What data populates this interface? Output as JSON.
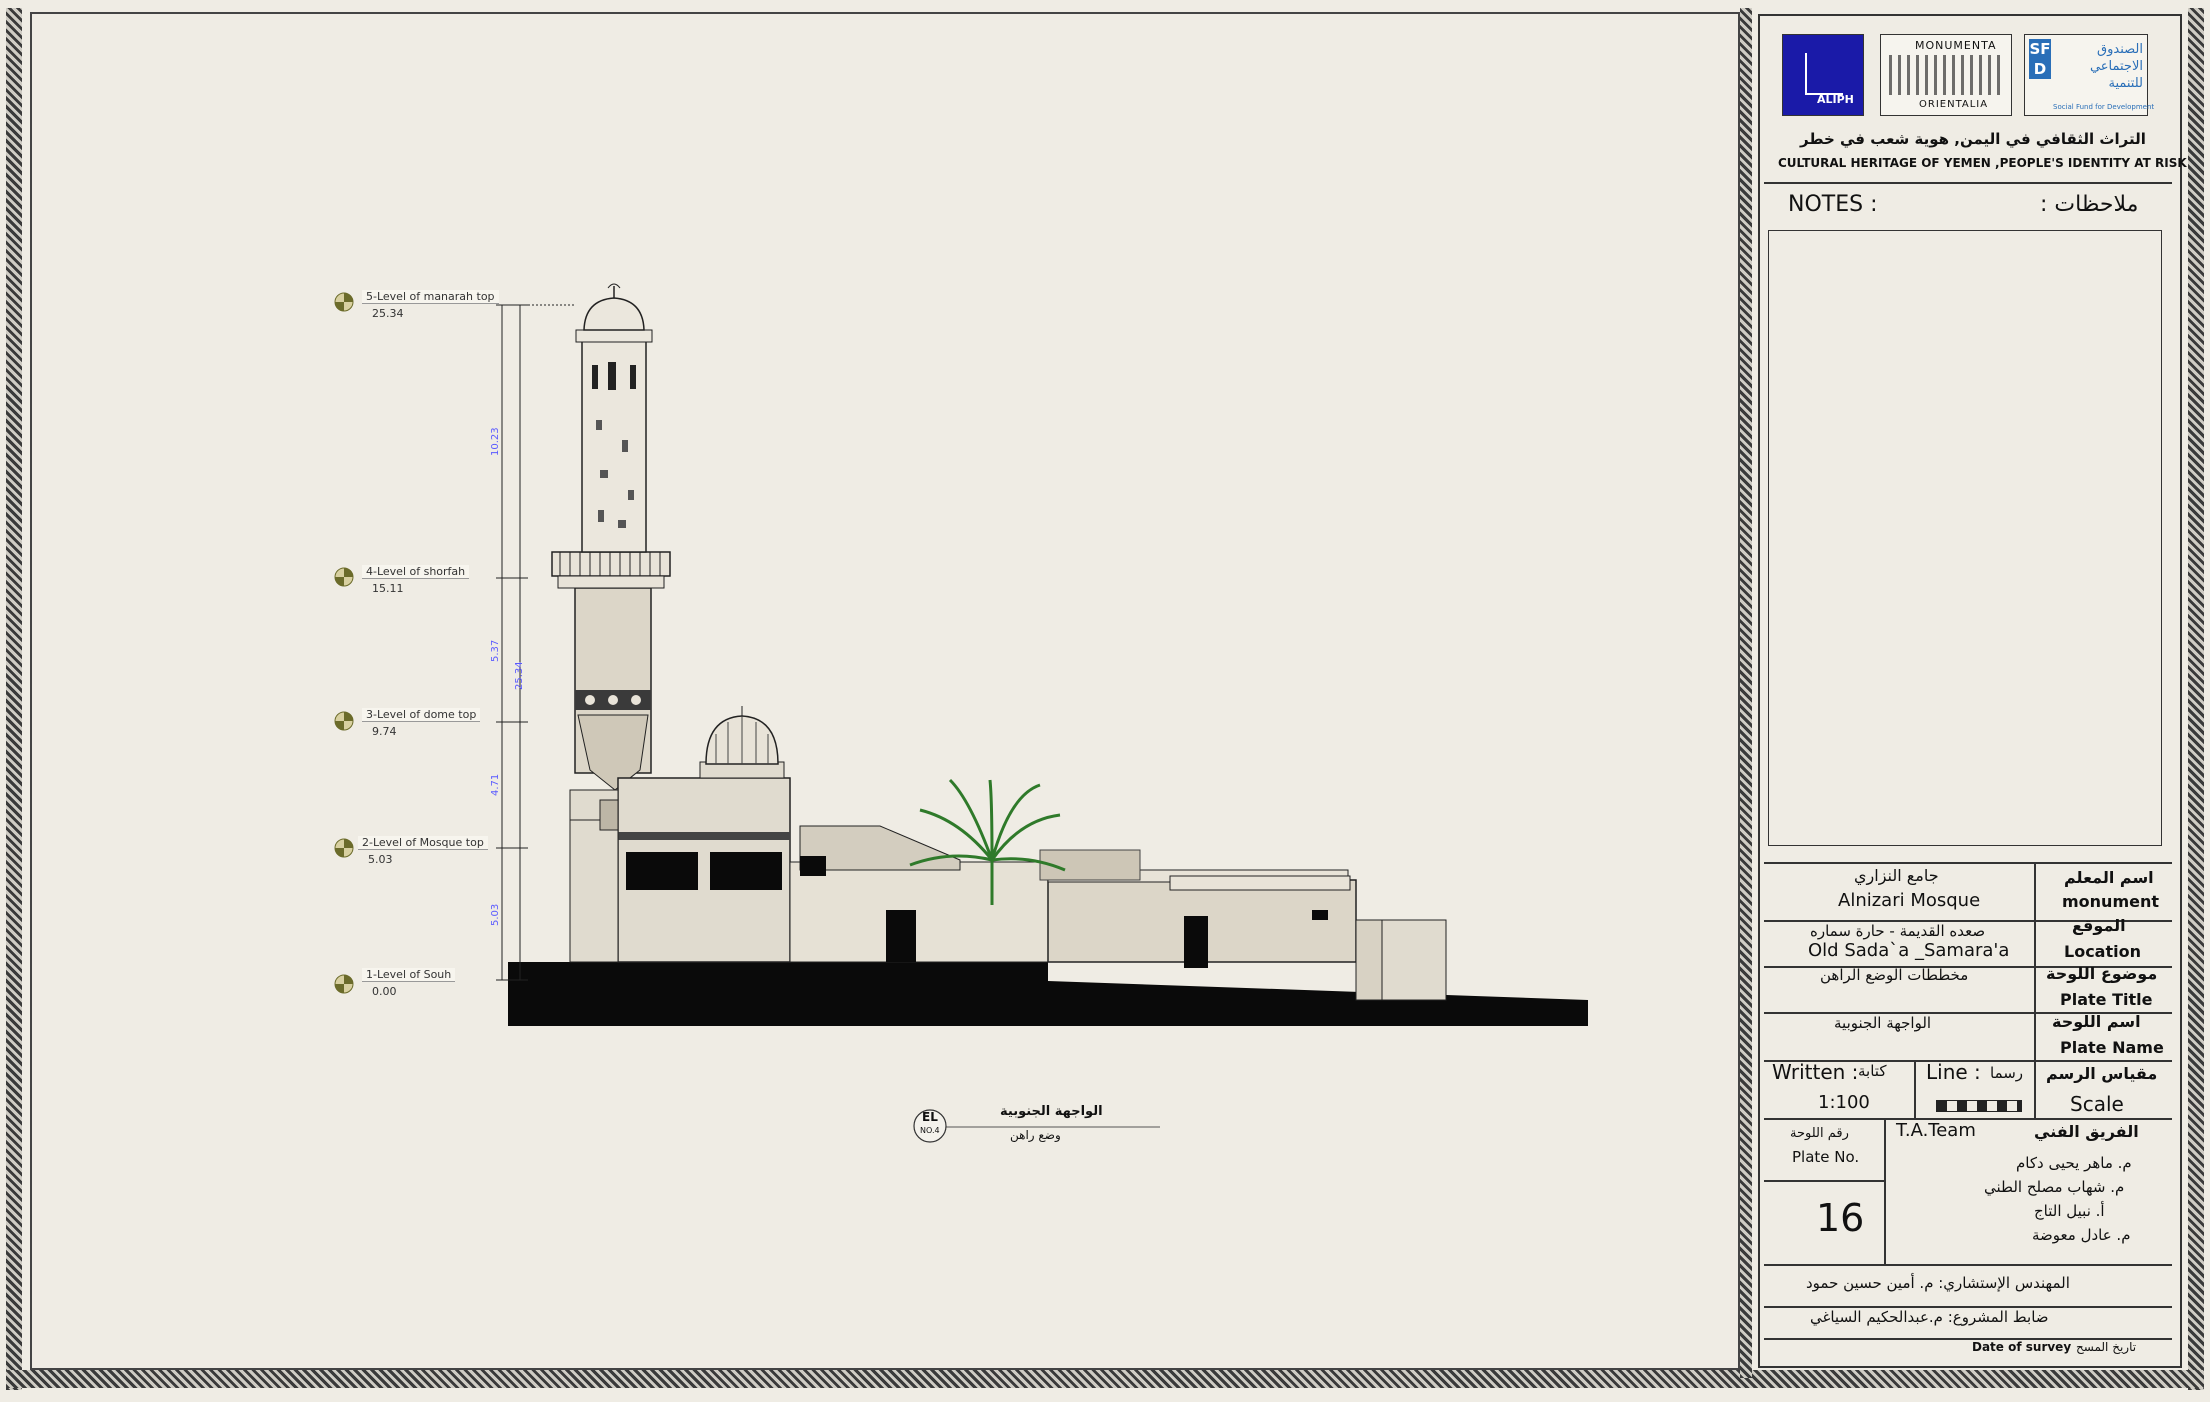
{
  "logos": {
    "aliph": "ALIPH",
    "monumenta_top": "MONUMENTA",
    "monumenta_bottom": "ORIENTALIA",
    "sfd_letters": "SFD",
    "sfd_arabic": "الصندوق الاجتماعي للتنمية",
    "sfd_english": "Social Fund for Development"
  },
  "header": {
    "title_ar": "التراث الثقافي في اليمن, هوية شعب في خطر",
    "title_en": "CULTURAL HERITAGE OF YEMEN ,PEOPLE'S IDENTITY AT RISK"
  },
  "notes": {
    "label_en": "NOTES :",
    "label_ar": "ملاحظات :"
  },
  "fields": {
    "monument_label_ar": "اسم المعلم",
    "monument_label_en": "monument",
    "monument_value_ar": "جامع النزاري",
    "monument_value_en": "Alnizari Mosque",
    "location_label_ar": "الموقع",
    "location_label_en": "Location",
    "location_value_ar": "صعده القديمة - حارة سماره",
    "location_value_en": "Old Sada`a _Samara'a",
    "plate_title_label_ar": "موضوع اللوحة",
    "plate_title_label_en": "Plate Title",
    "plate_title_value_ar": "مخططات الوضع الراهن",
    "plate_name_label_ar": "اسم اللوحة",
    "plate_name_label_en": "Plate Name",
    "plate_name_value_ar": "الواجهة الجنوبية",
    "scale_label_ar": "مقياس الرسم",
    "scale_label_en": "Scale",
    "written_en": "Written :",
    "written_ar": "كتابة",
    "line_en": "Line :",
    "line_ar": "رسما",
    "scale_value": "1:100",
    "plate_no_ar": "رقم اللوحة",
    "plate_no_en": "Plate No.",
    "plate_no_value": "16",
    "team_label_ar": "الفريق الفني",
    "team_label_en": "T.A.Team",
    "team_members": [
      "م. ماهر يحيى دكام",
      "م. شهاب مصلح الطني",
      "أ. نبيل التاج",
      "م. عادل معوضة"
    ],
    "consultant": "المهندس الإستشاري: م. أمين حسين حمود",
    "controller": "ضابط المشروع: م.عبدالحكيم السياغي",
    "survey_date_en": "Date of survey",
    "survey_date_ar": "تاريخ المسح"
  },
  "levels": [
    {
      "name": "5-Level of manarah top",
      "value": "25.34"
    },
    {
      "name": "4-Level of shorfah",
      "value": "15.11"
    },
    {
      "name": "3-Level of dome top",
      "value": "9.74"
    },
    {
      "name": "2-Level of Mosque top",
      "value": "5.03"
    },
    {
      "name": "1-Level of Souh",
      "value": "0.00"
    }
  ],
  "dimensions": {
    "d1": "10.23",
    "d2": "5.37",
    "d3": "4.71",
    "d4": "5.03",
    "total": "25.34"
  },
  "drawing_label": {
    "badge_top": "EL",
    "badge_bottom": "NO.4",
    "title_ar": "الواجهة الجنوبية",
    "subtitle_ar": "وضع راهن"
  }
}
